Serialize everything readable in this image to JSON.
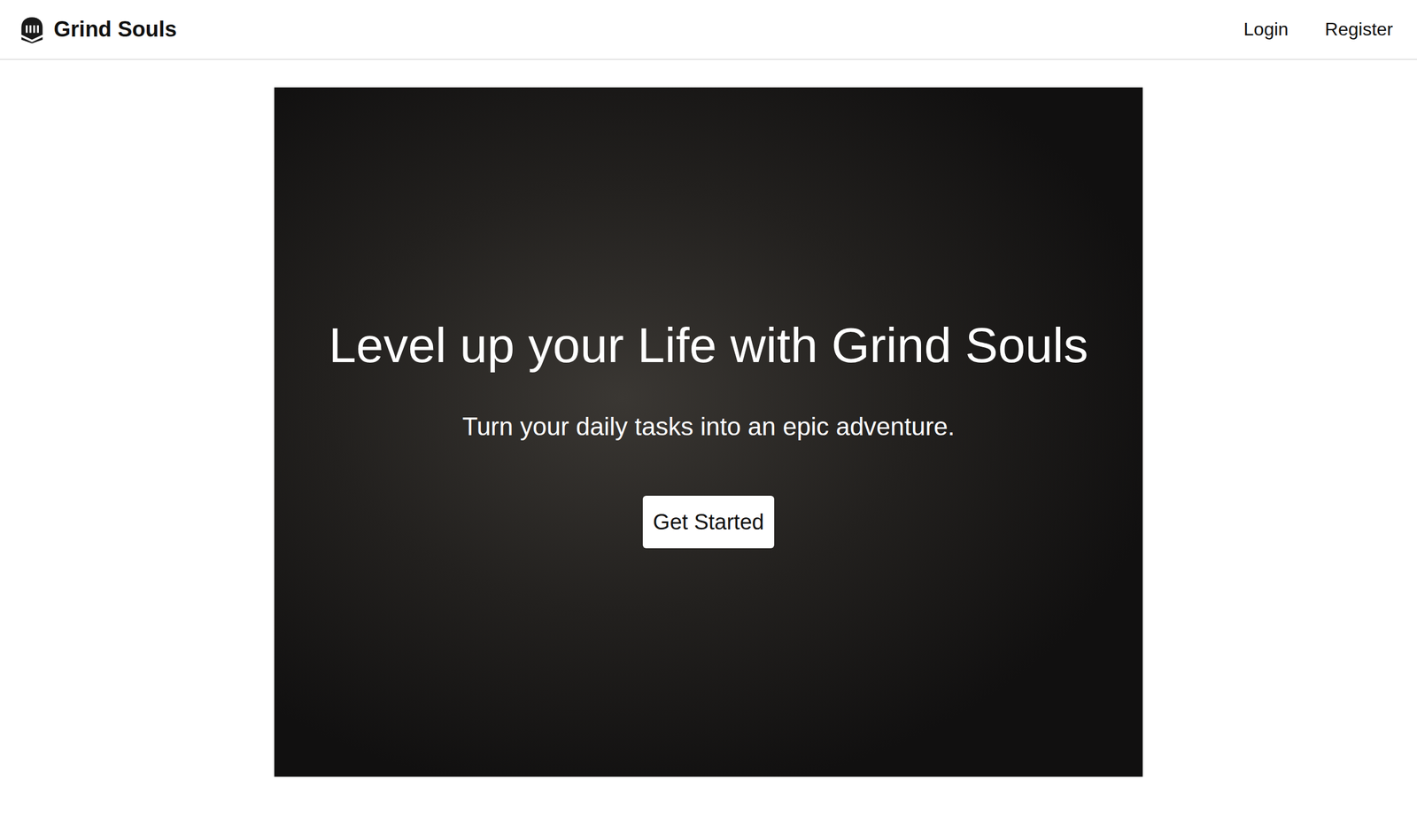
{
  "header": {
    "brand": "Grind Souls",
    "nav": [
      "Login",
      "Register"
    ]
  },
  "hero": {
    "title": "Level up your Life with Grind Souls",
    "subtitle": "Turn your daily tasks into an epic adventure.",
    "button": "Get Started"
  }
}
